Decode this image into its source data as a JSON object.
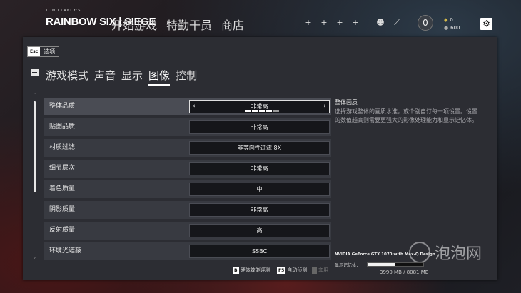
{
  "header": {
    "logo_sub": "TOM CLANCY'S",
    "logo": "RAINBOW SIX | SIEGE",
    "nav": [
      "开始游戏",
      "特勤干员",
      "商店"
    ],
    "slots": [
      "+",
      "+",
      "+",
      "+"
    ],
    "badge": "0",
    "currency_top": "0",
    "currency_bottom": "600"
  },
  "panel": {
    "esc_key": "Esc",
    "esc_label": "选项",
    "tabs": [
      "游戏模式",
      "声音",
      "显示",
      "图像",
      "控制"
    ],
    "active_tab": "图像"
  },
  "settings": [
    {
      "label": "整体品质",
      "value": "非常高",
      "selected": true
    },
    {
      "label": "贴图品质",
      "value": "非常高"
    },
    {
      "label": "材质过滤",
      "value": "非等向性过滤 8X"
    },
    {
      "label": "细节层次",
      "value": "非常高"
    },
    {
      "label": "着色质量",
      "value": "中"
    },
    {
      "label": "阴影质量",
      "value": "非常高"
    },
    {
      "label": "反射质量",
      "value": "高"
    },
    {
      "label": "环境光遮蔽",
      "value": "SSBC"
    }
  ],
  "quality_level_fraction": 0.8,
  "description": {
    "title": "整体画质",
    "text": "选择游戏整体的画质水准，或个别自订每一项设置。设置的数值越高则需要更强大的影像处理能力和显示记忆体。"
  },
  "gpu": {
    "name": "NVIDIA GeForce GTX 1070 with Max-Q Design",
    "vram_label": "显示记忆体：",
    "vram_used": "3990 MB",
    "vram_total": "8081 MB",
    "vram_text": "3990 MB / 8081 MB",
    "vram_fraction": 0.49
  },
  "actions": [
    {
      "key": "B",
      "label": "硬体效能评测"
    },
    {
      "key": "F5",
      "label": "自动侦测"
    },
    {
      "key": "",
      "label": "套用",
      "disabled": true
    }
  ],
  "watermark": "泡泡网"
}
